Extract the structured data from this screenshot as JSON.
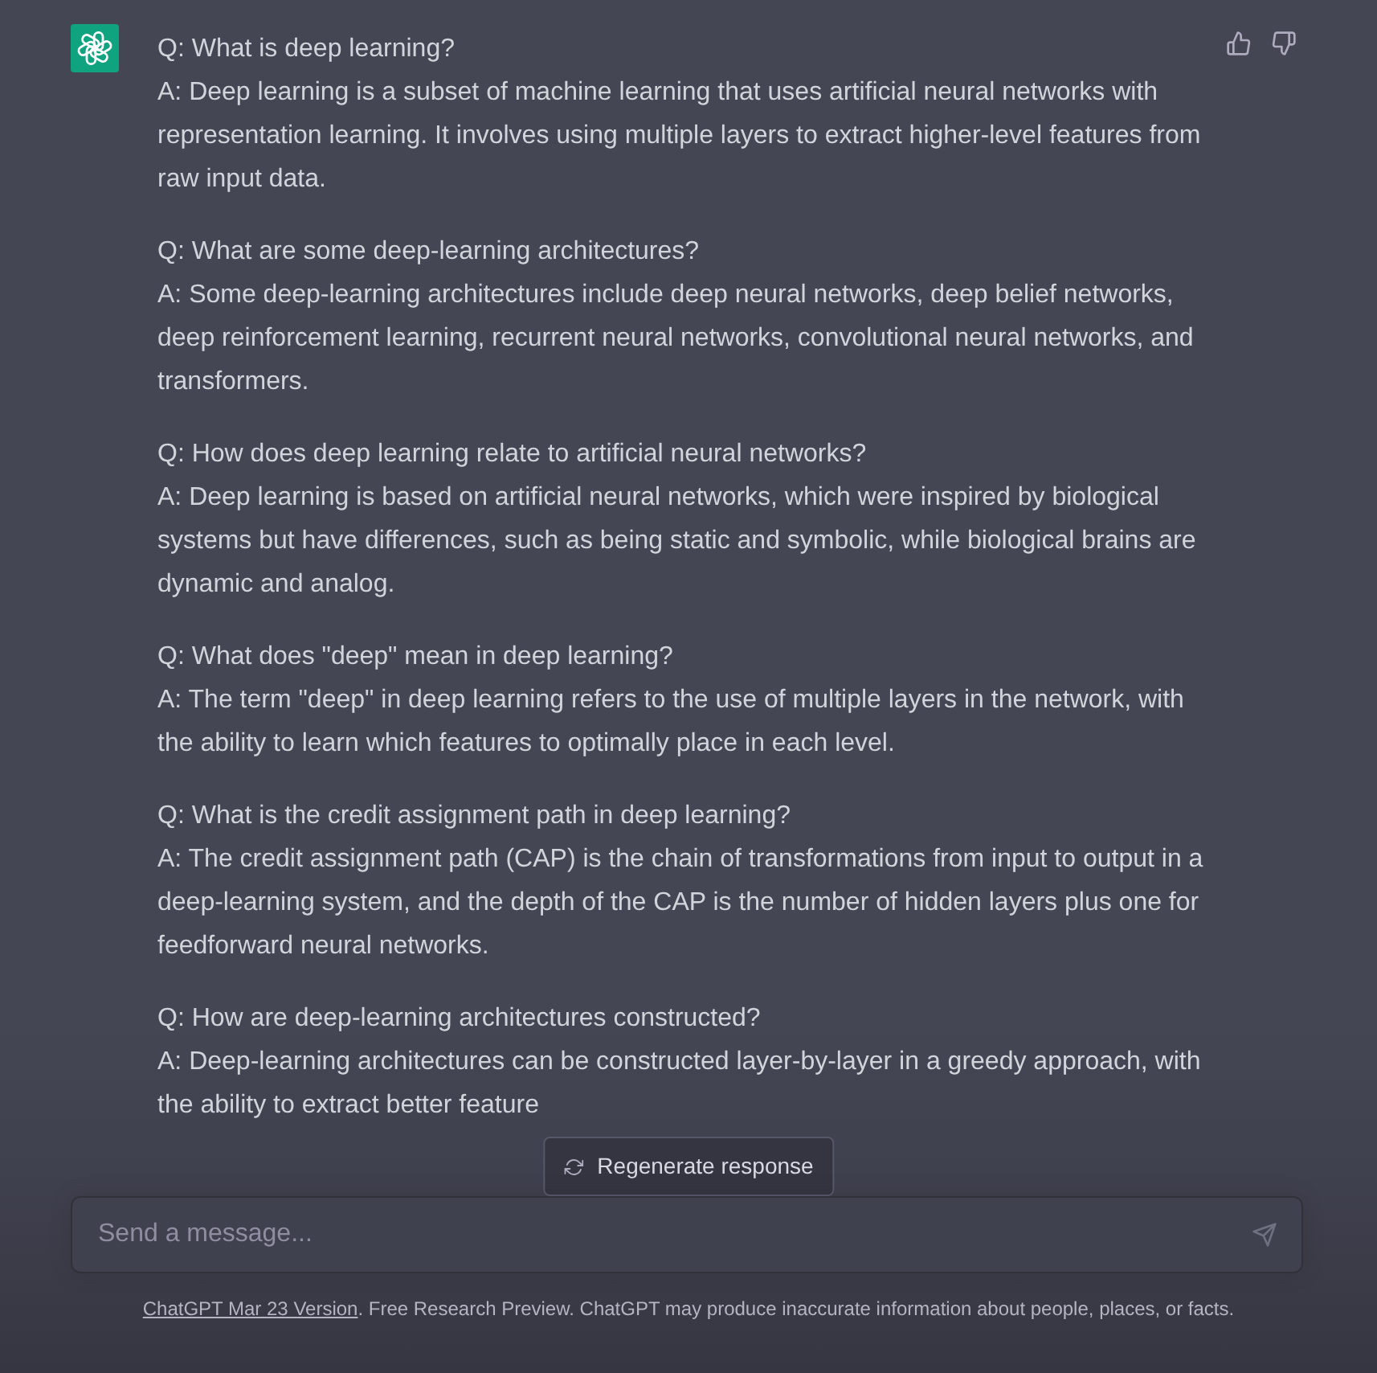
{
  "message": {
    "qa_pairs": [
      {
        "question": "Q: What is deep learning?",
        "answer": "A: Deep learning is a subset of machine learning that uses artificial neural networks with representation learning. It involves using multiple layers to extract higher-level features from raw input data."
      },
      {
        "question": "Q: What are some deep-learning architectures?",
        "answer": "A: Some deep-learning architectures include deep neural networks, deep belief networks, deep reinforcement learning, recurrent neural networks, convolutional neural networks, and transformers."
      },
      {
        "question": "Q: How does deep learning relate to artificial neural networks?",
        "answer": "A: Deep learning is based on artificial neural networks, which were inspired by biological systems but have differences, such as being static and symbolic, while biological brains are dynamic and analog."
      },
      {
        "question": "Q: What does \"deep\" mean in deep learning?",
        "answer": "A: The term \"deep\" in deep learning refers to the use of multiple layers in the network, with the ability to learn which features to optimally place in each level."
      },
      {
        "question": "Q: What is the credit assignment path in deep learning?",
        "answer": "A: The credit assignment path (CAP) is the chain of transformations from input to output in a deep-learning system, and the depth of the CAP is the number of hidden layers plus one for feedforward neural networks."
      },
      {
        "question": "Q: How are deep-learning architectures constructed?",
        "answer": "A: Deep-learning architectures can be constructed layer-by-layer in a greedy approach, with the ability to extract better feature"
      }
    ]
  },
  "regenerate_button": {
    "label": "Regenerate response"
  },
  "composer": {
    "placeholder": "Send a message..."
  },
  "footer": {
    "link": "ChatGPT Mar 23 Version",
    "text": ". Free Research Preview. ChatGPT may produce inaccurate information about people, places, or facts."
  }
}
